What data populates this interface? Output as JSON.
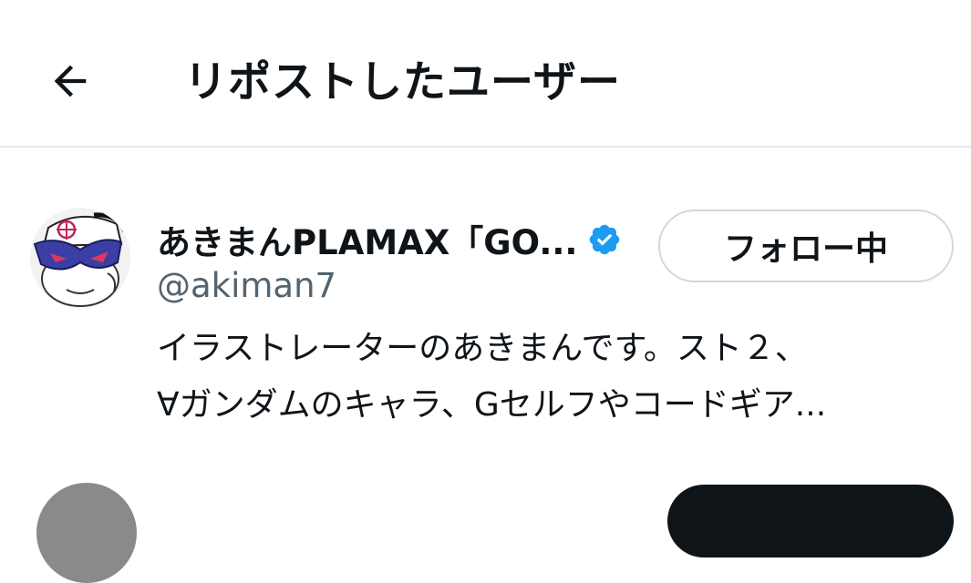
{
  "header": {
    "back_icon": "arrow-left-icon",
    "title": "リポストしたユーザー"
  },
  "user": {
    "display_name": "あきまんPLAMAX「GO...",
    "verified_icon": "verified-badge-icon",
    "verified_color": "#1d9bf0",
    "handle": "@akiman7",
    "follow_button_label": "フォロー中",
    "bio_lines": [
      "イラストレーターのあきまんです。スト２、",
      "∀ガンダムのキャラ、Gセルフやコードギア..."
    ]
  },
  "colors": {
    "text_primary": "#0f1419",
    "text_secondary": "#536471",
    "divider": "#e6e8ea",
    "button_border": "#cfd9de"
  }
}
